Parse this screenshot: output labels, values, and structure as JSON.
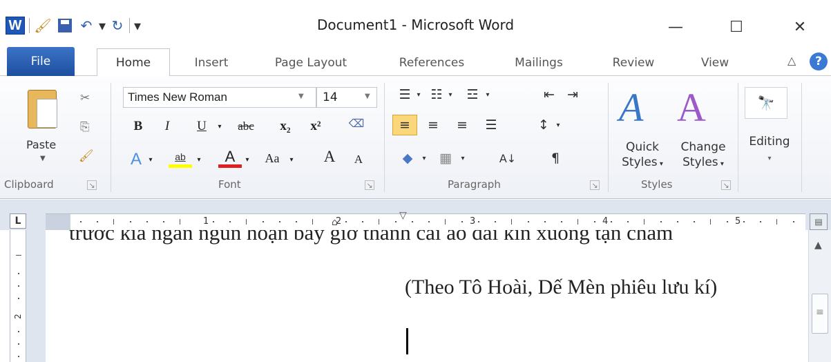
{
  "window": {
    "title": "Document1 - Microsoft Word",
    "app_icon": "W",
    "minimize": "—",
    "maximize": "☐",
    "close": "✕"
  },
  "tabs": {
    "file": "File",
    "home": "Home",
    "insert": "Insert",
    "page_layout": "Page Layout",
    "references": "References",
    "mailings": "Mailings",
    "review": "Review",
    "view": "View",
    "help": "?"
  },
  "ribbon": {
    "clipboard": {
      "paste_label": "Paste",
      "group_label": "Clipboard"
    },
    "font": {
      "font_name": "Times New Roman",
      "font_size": "14",
      "bold": "B",
      "italic": "I",
      "underline": "U",
      "strikethrough": "abc",
      "subscript": "x₂",
      "superscript": "x²",
      "change_case": "Aa",
      "grow": "A",
      "shrink": "A",
      "font_color": "A",
      "highlight": "ab",
      "group_label": "Font"
    },
    "paragraph": {
      "group_label": "Paragraph",
      "show_marks": "¶"
    },
    "styles": {
      "quick_styles_line1": "Quick",
      "quick_styles_line2": "Styles",
      "change_styles_line1": "Change",
      "change_styles_line2": "Styles",
      "group_label": "Styles"
    },
    "editing": {
      "label": "Editing"
    }
  },
  "ruler": {
    "tab_selector": "L",
    "numbers": [
      "1",
      "2",
      "3",
      "4",
      "5"
    ]
  },
  "vruler": {
    "numbers": [
      "2"
    ]
  },
  "document": {
    "partial_line": "trước kia ngắn ngủn hoạn bay giờ thanh cái áo dài kín xuống tận chấm",
    "citation": "(Theo Tô Hoài, Dế Mèn phiêu lưu kí)"
  },
  "colors": {
    "file_tab": "#2a62b4",
    "highlight_yellow": "#ffff00",
    "font_color_red": "#e02020",
    "active_align": "#fbd77c",
    "ribbon_bg": "#eef1f6"
  }
}
